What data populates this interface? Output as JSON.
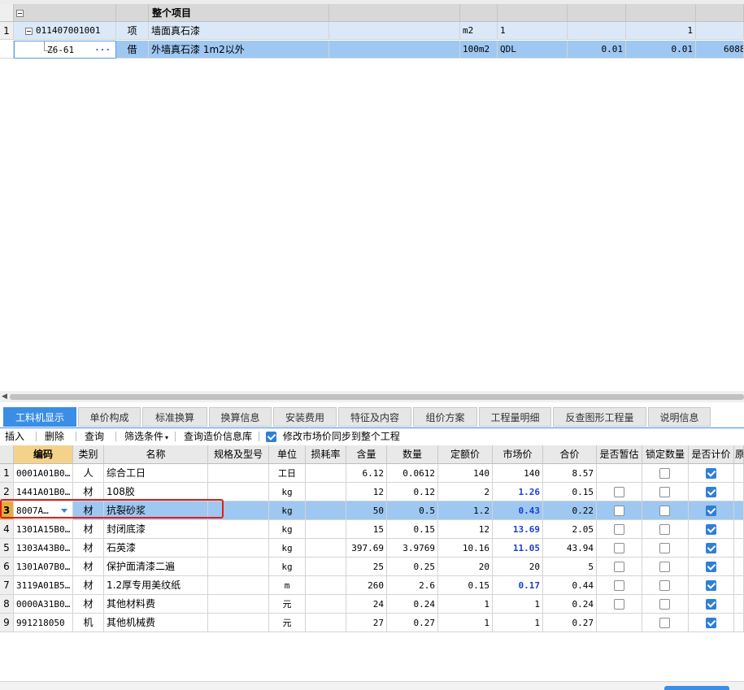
{
  "top_table": {
    "whole_project": {
      "label": "整个项目"
    },
    "item_row": {
      "row_no": "1",
      "code": "011407001001",
      "category": "项",
      "name": "墙面真石漆",
      "unit": "m2",
      "expr": "1",
      "qty": "1"
    },
    "sub_row": {
      "code": "Z6-61",
      "category": "借",
      "name": "外墙真石漆 1m2以外",
      "unit": "100m2",
      "expr": "QDL",
      "content": "0.01",
      "qty": "0.01",
      "price": "6088"
    }
  },
  "tabs": [
    "工料机显示",
    "单价构成",
    "标准换算",
    "换算信息",
    "安装费用",
    "特征及内容",
    "组价方案",
    "工程量明细",
    "反查图形工程量",
    "说明信息"
  ],
  "toolbar": {
    "insert": "插入",
    "delete": "删除",
    "query": "查询",
    "filter": "筛选条件",
    "query_price_lib": "查询造价信息库",
    "sync_label": "修改市场价同步到整个工程",
    "sync_checked": true
  },
  "grid": {
    "headers": [
      "编码",
      "类别",
      "名称",
      "规格及型号",
      "单位",
      "损耗率",
      "含量",
      "数量",
      "定额价",
      "市场价",
      "合价",
      "是否暂估",
      "锁定数量",
      "是否计价",
      "原"
    ],
    "rows": [
      {
        "no": "1",
        "code": "0001A01B0…",
        "type": "人",
        "name": "综合工日",
        "spec": "",
        "unit": "工日",
        "loss": "",
        "content": "6.12",
        "qty": "0.0612",
        "base_price": "140",
        "market_price": "140",
        "market_blue": false,
        "total": "8.57",
        "provisional": null,
        "lock": false,
        "priced": true
      },
      {
        "no": "2",
        "code": "1441A01B0…",
        "type": "材",
        "name": "108胶",
        "spec": "",
        "unit": "kg",
        "loss": "",
        "content": "12",
        "qty": "0.12",
        "base_price": "2",
        "market_price": "1.26",
        "market_blue": true,
        "total": "0.15",
        "provisional": false,
        "lock": false,
        "priced": true
      },
      {
        "no": "3",
        "code": "8007A…",
        "type": "材",
        "name": "抗裂砂浆",
        "spec": "",
        "unit": "kg",
        "loss": "",
        "content": "50",
        "qty": "0.5",
        "base_price": "1.2",
        "market_price": "0.43",
        "market_blue": true,
        "total": "0.22",
        "provisional": false,
        "lock": false,
        "priced": true
      },
      {
        "no": "4",
        "code": "1301A15B0…",
        "type": "材",
        "name": "封闭底漆",
        "spec": "",
        "unit": "kg",
        "loss": "",
        "content": "15",
        "qty": "0.15",
        "base_price": "12",
        "market_price": "13.69",
        "market_blue": true,
        "total": "2.05",
        "provisional": false,
        "lock": false,
        "priced": true
      },
      {
        "no": "5",
        "code": "1303A43B0…",
        "type": "材",
        "name": "石英漆",
        "spec": "",
        "unit": "kg",
        "loss": "",
        "content": "397.69",
        "qty": "3.9769",
        "base_price": "10.16",
        "market_price": "11.05",
        "market_blue": true,
        "total": "43.94",
        "provisional": false,
        "lock": false,
        "priced": true
      },
      {
        "no": "6",
        "code": "1301A07B0…",
        "type": "材",
        "name": "保护面清漆二遍",
        "spec": "",
        "unit": "kg",
        "loss": "",
        "content": "25",
        "qty": "0.25",
        "base_price": "20",
        "market_price": "20",
        "market_blue": false,
        "total": "5",
        "provisional": false,
        "lock": false,
        "priced": true
      },
      {
        "no": "7",
        "code": "3119A01B5…",
        "type": "材",
        "name": "1.2厚专用美纹纸",
        "spec": "",
        "unit": "m",
        "loss": "",
        "content": "260",
        "qty": "2.6",
        "base_price": "0.15",
        "market_price": "0.17",
        "market_blue": true,
        "total": "0.44",
        "provisional": false,
        "lock": false,
        "priced": true
      },
      {
        "no": "8",
        "code": "0000A31B0…",
        "type": "材",
        "name": "其他材料费",
        "spec": "",
        "unit": "元",
        "loss": "",
        "content": "24",
        "qty": "0.24",
        "base_price": "1",
        "market_price": "1",
        "market_blue": false,
        "total": "0.24",
        "provisional": false,
        "lock": false,
        "priced": true
      },
      {
        "no": "9",
        "code": "991218050",
        "type": "机",
        "name": "其他机械费",
        "spec": "",
        "unit": "元",
        "loss": "",
        "content": "27",
        "qty": "0.27",
        "base_price": "1",
        "market_price": "1",
        "market_blue": false,
        "total": "0.27",
        "provisional": null,
        "lock": false,
        "priced": true
      }
    ]
  },
  "colors": {
    "accent": "#3a8ee6",
    "selected_row": "#9ec8f2",
    "highlight_box": "#e21d1d",
    "market_price_blue": "#1a3fd0"
  }
}
